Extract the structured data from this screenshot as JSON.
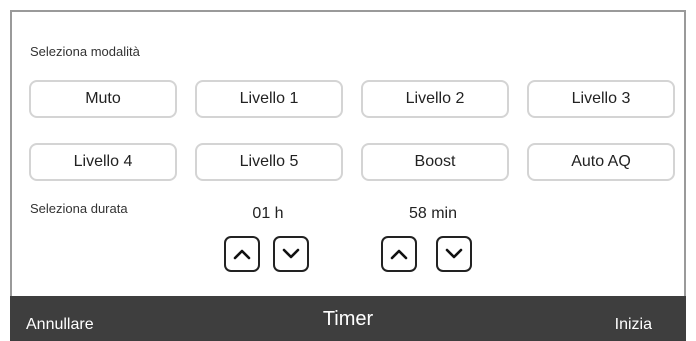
{
  "mode_section": {
    "label": "Seleziona modalità",
    "buttons": [
      "Muto",
      "Livello 1",
      "Livello 2",
      "Livello 3",
      "Livello 4",
      "Livello 5",
      "Boost",
      "Auto AQ"
    ]
  },
  "duration_section": {
    "label": "Seleziona durata",
    "hours": "01 h",
    "minutes": "58 min"
  },
  "icons": {
    "up": "chevron-up-icon",
    "down": "chevron-down-icon"
  },
  "footer": {
    "cancel_label": "Annullare",
    "title": "Timer",
    "start_label": "Inizia"
  },
  "colors": {
    "footer_bg": "#3e3e3e",
    "button_border": "#d4d4d4",
    "stepper_border": "#222222"
  }
}
